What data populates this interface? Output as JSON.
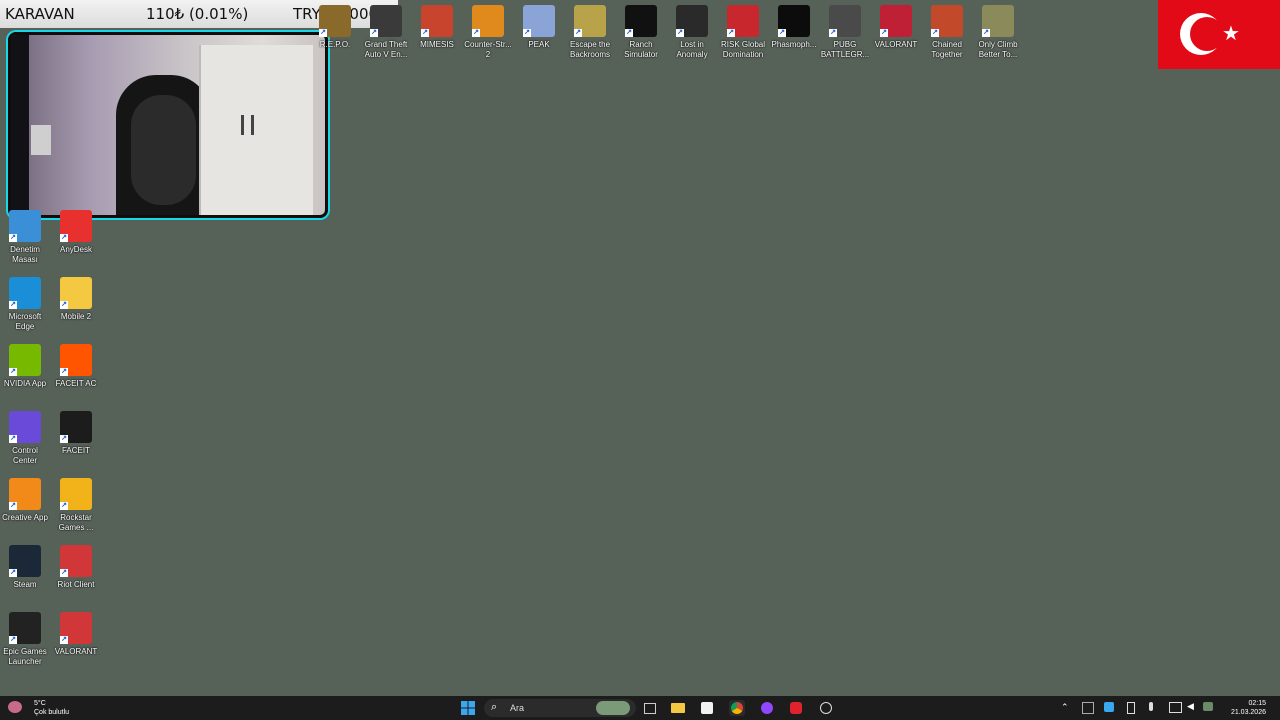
{
  "overlay": {
    "name": "KARAVAN",
    "change": "110₺ (0.01%)",
    "goal": "TRY1000000"
  },
  "top_icons": [
    {
      "label": "R.E.P.O.",
      "icon": "repo-icon",
      "color": "#8a6a2a"
    },
    {
      "label": "Grand Theft Auto V En...",
      "icon": "gta-icon",
      "color": "#3a3a3a"
    },
    {
      "label": "MIMESIS",
      "icon": "mimesis-icon",
      "color": "#c8442c"
    },
    {
      "label": "Counter-Str... 2",
      "icon": "cs2-icon",
      "color": "#e08a1e"
    },
    {
      "label": "PEAK",
      "icon": "peak-icon",
      "color": "#8aa4d8"
    },
    {
      "label": "Escape the Backrooms",
      "icon": "backrooms-icon",
      "color": "#b8a24a"
    },
    {
      "label": "Ranch Simulator",
      "icon": "ranch-icon",
      "color": "#111111"
    },
    {
      "label": "Lost in Anomaly",
      "icon": "anomaly-icon",
      "color": "#2a2a2a"
    },
    {
      "label": "RISK Global Domination",
      "icon": "risk-icon",
      "color": "#c9272e"
    },
    {
      "label": "Phasmoph...",
      "icon": "phasmophobia-icon",
      "color": "#0c0c0c"
    },
    {
      "label": "PUBG BATTLEGR...",
      "icon": "pubg-icon",
      "color": "#4a4a4a"
    },
    {
      "label": "VALORANT",
      "icon": "valorant-icon",
      "color": "#bf2035"
    },
    {
      "label": "Chained Together",
      "icon": "chained-icon",
      "color": "#c24a2a"
    },
    {
      "label": "Only Climb Better To...",
      "icon": "onlyclimb-icon",
      "color": "#8a8a5a"
    }
  ],
  "left_icons": [
    {
      "label": "Denetim Masası",
      "icon": "control-panel-icon",
      "color": "#3b8fd6"
    },
    {
      "label": "AnyDesk",
      "icon": "anydesk-icon",
      "color": "#e8312f"
    },
    {
      "label": "Microsoft Edge",
      "icon": "edge-icon",
      "color": "#1a8fd8"
    },
    {
      "label": "Mobile 2",
      "icon": "folder-icon",
      "color": "#f5c842"
    },
    {
      "label": "NVIDIA App",
      "icon": "nvidia-icon",
      "color": "#76b900"
    },
    {
      "label": "FACEIT AC",
      "icon": "faceit-ac-icon",
      "color": "#ff5500"
    },
    {
      "label": "Control Center",
      "icon": "control-center-icon",
      "color": "#6a4ad8"
    },
    {
      "label": "FACEIT",
      "icon": "faceit-icon",
      "color": "#1c1c1c"
    },
    {
      "label": "Creative App",
      "icon": "creative-app-icon",
      "color": "#f28a1a"
    },
    {
      "label": "Rockstar Games ...",
      "icon": "rockstar-icon",
      "color": "#f2b21a"
    },
    {
      "label": "Steam",
      "icon": "steam-icon",
      "color": "#1b2838"
    },
    {
      "label": "Riot Client",
      "icon": "riot-icon",
      "color": "#d13639"
    },
    {
      "label": "Epic Games Launcher",
      "icon": "epic-icon",
      "color": "#222222"
    },
    {
      "label": "VALORANT",
      "icon": "valorant-riot-icon",
      "color": "#d13639"
    }
  ],
  "taskbar": {
    "weather_temp": "5°C",
    "weather_desc": "Çok bulutlu",
    "search_placeholder": "Ara",
    "time": "02:15",
    "date": "21.03.2026"
  }
}
